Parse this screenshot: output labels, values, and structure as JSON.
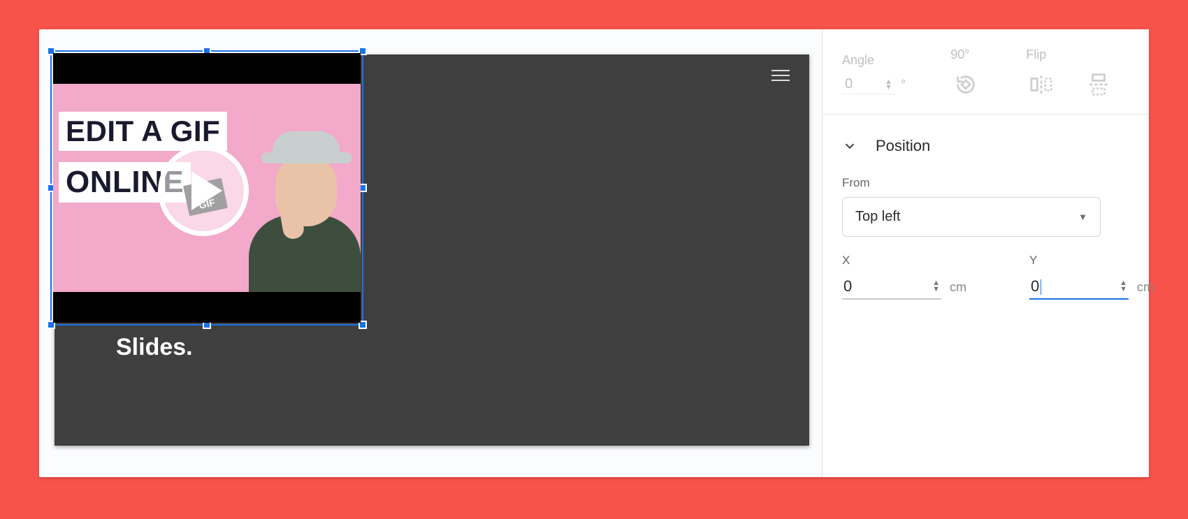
{
  "slide": {
    "caption": "Slides."
  },
  "video": {
    "title_line1": "EDIT A GIF",
    "title_line2": "ONLINE",
    "badge": "GIF"
  },
  "rotation": {
    "angle_label": "Angle",
    "angle_value": "0",
    "ninety_label": "90°",
    "flip_label": "Flip"
  },
  "position": {
    "section_title": "Position",
    "from_label": "From",
    "from_value": "Top left",
    "x_label": "X",
    "y_label": "Y",
    "x_value": "0",
    "y_value": "0",
    "x_unit": "cm",
    "y_unit": "cm"
  }
}
